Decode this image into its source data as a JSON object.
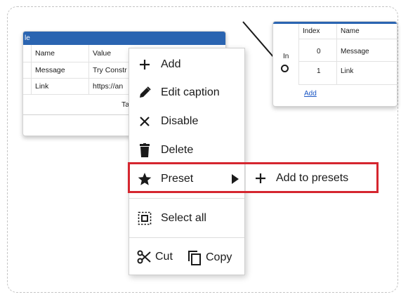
{
  "left_node": {
    "title_fragment": "le",
    "columns": [
      "Name",
      "Value"
    ],
    "rows": [
      {
        "name": "Message",
        "value": "Try Constr"
      },
      {
        "name": "Link",
        "value": "https://an"
      }
    ],
    "footer_fragment": "Ta"
  },
  "right_node": {
    "port_label": "In",
    "columns": [
      "Index",
      "Name"
    ],
    "rows": [
      {
        "index": "0",
        "name": "Message"
      },
      {
        "index": "1",
        "name": "Link"
      }
    ],
    "add_link": "Add"
  },
  "context_menu": {
    "items": [
      {
        "label": "Add",
        "icon": "plus-icon"
      },
      {
        "label": "Edit caption",
        "icon": "pencil-icon"
      },
      {
        "label": "Disable",
        "icon": "x-icon"
      },
      {
        "label": "Delete",
        "icon": "trash-icon"
      },
      {
        "label": "Preset",
        "icon": "star-icon",
        "has_submenu": true
      },
      {
        "label": "Select all",
        "icon": "select-all-icon"
      }
    ],
    "cut_label": "Cut",
    "copy_label": "Copy"
  },
  "submenu": {
    "items": [
      {
        "label": "Add to presets",
        "icon": "plus-icon"
      }
    ]
  },
  "colors": {
    "node_header": "#2a64b1",
    "highlight": "#d5262f",
    "link": "#1a56c4"
  }
}
